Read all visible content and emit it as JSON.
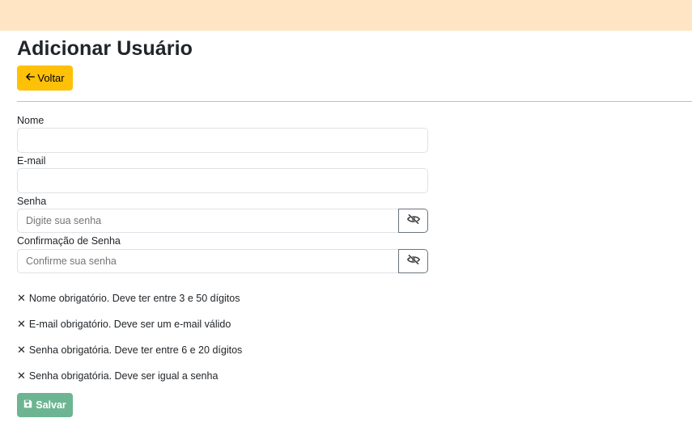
{
  "page": {
    "title": "Adicionar Usuário",
    "back_label": "Voltar",
    "save_label": "Salvar"
  },
  "form": {
    "nome": {
      "label": "Nome",
      "value": "",
      "placeholder": ""
    },
    "email": {
      "label": "E-mail",
      "value": "",
      "placeholder": ""
    },
    "senha": {
      "label": "Senha",
      "value": "",
      "placeholder": "Digite sua senha"
    },
    "confirmacao": {
      "label": "Confirmação de Senha",
      "value": "",
      "placeholder": "Confirme sua senha"
    }
  },
  "validation": [
    {
      "icon": "✕",
      "text": "Nome obrigatório. Deve ter entre 3 e 50 dígitos"
    },
    {
      "icon": "✕",
      "text": "E-mail obrigatório. Deve ser um e-mail válido"
    },
    {
      "icon": "✕",
      "text": "Senha obrigatória. Deve ter entre 6 e 20 dígitos"
    },
    {
      "icon": "✕",
      "text": "Senha obrigatória. Deve ser igual a senha"
    }
  ],
  "icons": {
    "back": "arrow-left-icon",
    "toggle_password": "eye-slash-icon",
    "save": "floppy-disk-icon"
  },
  "colors": {
    "topbar": "#ffe5c4",
    "back_button": "#ffc107",
    "save_button": "#6db592"
  }
}
